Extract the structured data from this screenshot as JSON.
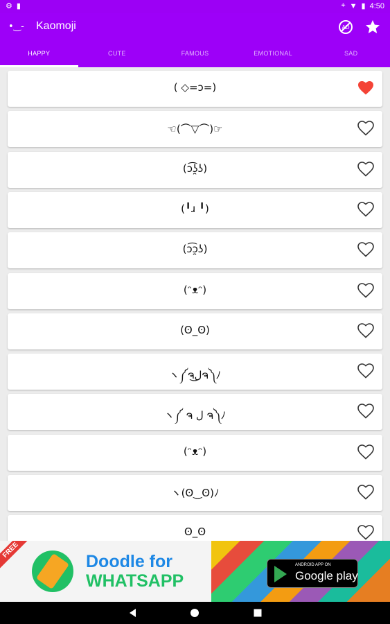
{
  "status_bar": {
    "time": "4:50"
  },
  "app_bar": {
    "logo": "•‿-",
    "title": "Kaomoji"
  },
  "tabs": [
    {
      "label": "HAPPY",
      "active": true
    },
    {
      "label": "CUTE",
      "active": false
    },
    {
      "label": "FAMOUS",
      "active": false
    },
    {
      "label": "EMOTIONAL",
      "active": false
    },
    {
      "label": "SAD",
      "active": false
    }
  ],
  "kaomoji": [
    {
      "text": "( ◇=ɔ=)",
      "favorite": true
    },
    {
      "text": "☜(⌒▽⌒)☞",
      "favorite": false
    },
    {
      "text": "(ɔ͡ʖ̯ʖ)",
      "favorite": false
    },
    {
      "text": "(╹ɹ ╹)",
      "favorite": false
    },
    {
      "text": "(ɔ͡ɔ̯ʖ)",
      "favorite": false
    },
    {
      "text": "(ᵔᴥᵔ)",
      "favorite": false
    },
    {
      "text": "(ʘ_ʘ)",
      "favorite": false
    },
    {
      "text": "ヽ༼ຈل͜ຈ༽ﾉ",
      "favorite": false
    },
    {
      "text": "ヽ༼ ຈ ل ຈ༽ﾉ",
      "favorite": false
    },
    {
      "text": "(ᵔᴥᵔ)",
      "favorite": false
    },
    {
      "text": "ヽ(ʘ‿ʘ)ﾉ",
      "favorite": false
    },
    {
      "text": "ʘ_ʘ",
      "favorite": false
    }
  ],
  "ad": {
    "ribbon": "FREE",
    "headline_1": "Doodle for",
    "headline_2": "WHATSAPP",
    "store_small": "ANDROID APP ON",
    "store_big": "Google play"
  },
  "colors": {
    "primary": "#9d00f8",
    "heart_filled": "#f44336"
  }
}
